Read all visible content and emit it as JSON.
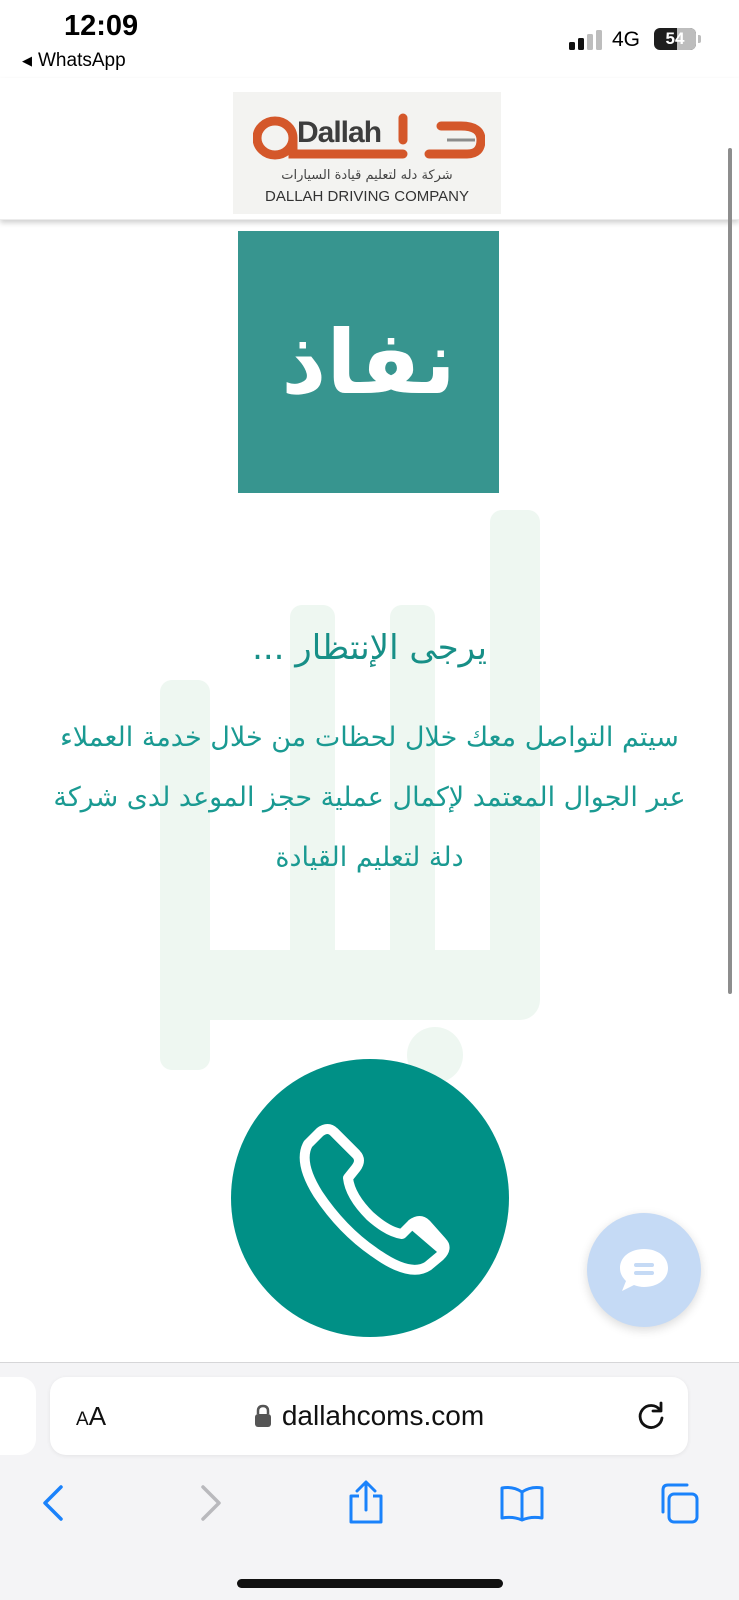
{
  "status_bar": {
    "time": "12:09",
    "back_app": "WhatsApp",
    "network": "4G",
    "battery": "54",
    "battery_level": 0.54
  },
  "header": {
    "logo_brand": "Dallah",
    "logo_arabic": "شركة دله لتعليم قيادة السيارات",
    "logo_english": "DALLAH DRIVING COMPANY"
  },
  "nafath": {
    "label": "نفاذ"
  },
  "content": {
    "waiting_title": "يرجى الإنتظار ...",
    "message": "سيتم التواصل معك خلال لحظات من خلال خدمة العملاء عبر الجوال المعتمد لإكمال عملية حجز الموعد لدى شركة دلة لتعليم القيادة"
  },
  "icons": {
    "call": "phone-icon",
    "chat": "chat-bubble-icon",
    "lock": "lock-icon",
    "reload": "reload-icon",
    "back": "chevron-left-icon",
    "forward": "chevron-right-icon",
    "share": "share-icon",
    "bookmarks": "book-icon",
    "tabs": "tabs-icon"
  },
  "colors": {
    "teal": "#009086",
    "nafath_bg": "#37958f",
    "text_teal": "#1a9a92",
    "logo_orange": "#d4572a",
    "chat_bg": "#c5daf5",
    "safari_blue": "#1a82fb"
  },
  "browser": {
    "aa_label_small": "A",
    "aa_label_large": "A",
    "url": "dallahcoms.com"
  }
}
